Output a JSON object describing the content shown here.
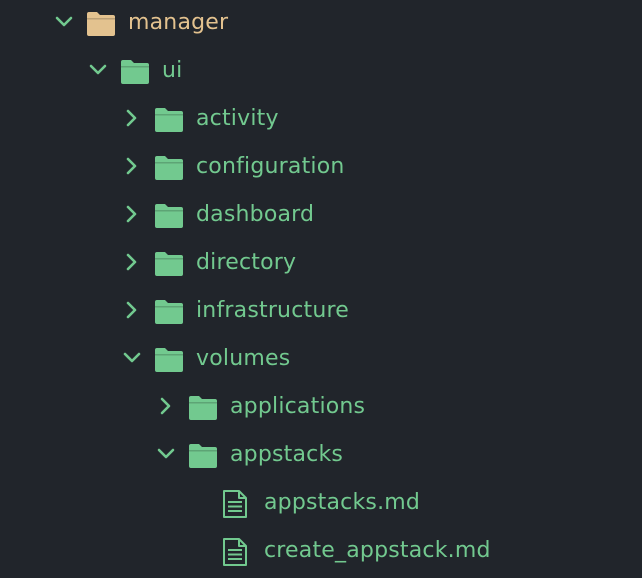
{
  "colors": {
    "background": "#21252b",
    "folder_root": "#e3c28f",
    "label_root": "#e3c28f",
    "folder": "#72c98f",
    "label": "#72c98f",
    "chevron": "#72c98f"
  },
  "tree": {
    "items": [
      {
        "label": "manager",
        "type": "folder",
        "expanded": true,
        "depth": 0,
        "icon": "folder-icon",
        "root": true
      },
      {
        "label": "ui",
        "type": "folder",
        "expanded": true,
        "depth": 1,
        "icon": "folder-icon"
      },
      {
        "label": "activity",
        "type": "folder",
        "expanded": false,
        "depth": 2,
        "icon": "folder-icon"
      },
      {
        "label": "configuration",
        "type": "folder",
        "expanded": false,
        "depth": 2,
        "icon": "folder-icon"
      },
      {
        "label": "dashboard",
        "type": "folder",
        "expanded": false,
        "depth": 2,
        "icon": "folder-icon"
      },
      {
        "label": "directory",
        "type": "folder",
        "expanded": false,
        "depth": 2,
        "icon": "folder-icon"
      },
      {
        "label": "infrastructure",
        "type": "folder",
        "expanded": false,
        "depth": 2,
        "icon": "folder-icon"
      },
      {
        "label": "volumes",
        "type": "folder",
        "expanded": true,
        "depth": 2,
        "icon": "folder-icon"
      },
      {
        "label": "applications",
        "type": "folder",
        "expanded": false,
        "depth": 3,
        "icon": "folder-icon"
      },
      {
        "label": "appstacks",
        "type": "folder",
        "expanded": true,
        "depth": 3,
        "icon": "folder-icon"
      },
      {
        "label": "appstacks.md",
        "type": "file",
        "depth": 4,
        "icon": "file-text-icon"
      },
      {
        "label": "create_appstack.md",
        "type": "file",
        "depth": 4,
        "icon": "file-text-icon"
      }
    ]
  }
}
